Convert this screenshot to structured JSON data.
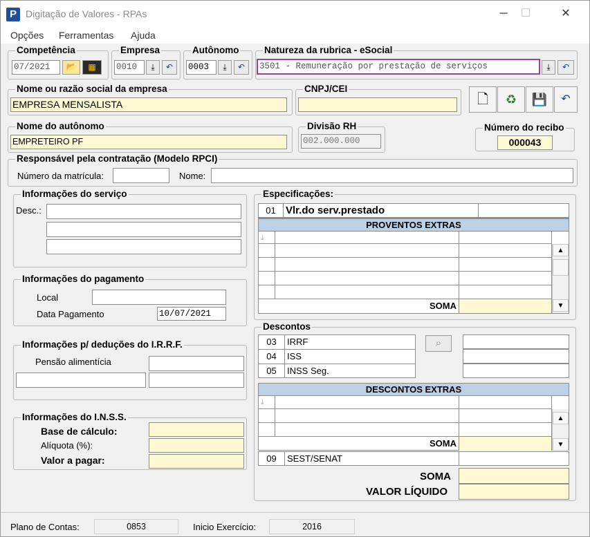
{
  "window": {
    "title": "Digitação de Valores - RPAs",
    "icon": "P",
    "minimize": "─",
    "maximize": "☐",
    "close": "✕"
  },
  "menu": [
    "Opções",
    "Ferramentas",
    "Ajuda"
  ],
  "competencia": {
    "label": "Competência",
    "value": "07/2021"
  },
  "empresa": {
    "label": "Empresa",
    "value": "0010"
  },
  "autonomo": {
    "label": "Autônomo",
    "value": "0003"
  },
  "natureza": {
    "label": "Natureza da rubrica - eSocial",
    "value": "3501 - Remuneração por prestação de serviços"
  },
  "razao": {
    "label": "Nome ou razão social da empresa",
    "value": "EMPRESA MENSALISTA"
  },
  "cnpj": {
    "label": "CNPJ/CEI",
    "value": ""
  },
  "nome_autonomo": {
    "label": "Nome do autônomo",
    "value": "EMPRETEIRO PF"
  },
  "divisao": {
    "label": "Divisão RH",
    "value": "002.000.000"
  },
  "recibo": {
    "label": "Número do recibo",
    "value": "000043"
  },
  "responsavel": {
    "label": "Responsável pela contratação (Modelo RPCI)",
    "matricula_label": "Número da matrícula:",
    "nome_label": "Nome:"
  },
  "servico": {
    "label": "Informações do serviço",
    "desc_label": "Desc.:"
  },
  "pagamento": {
    "label": "Informações do pagamento",
    "local_label": "Local",
    "data_label": "Data Pagamento",
    "data_value": "10/07/2021"
  },
  "irrf": {
    "label": "Informações p/ deduções do I.R.R.F.",
    "pensao_label": "Pensão alimentícia"
  },
  "inss": {
    "label": "Informações do I.N.S.S.",
    "base_label": "Base de cálculo:",
    "aliquota_label": "Alíquota (%):",
    "valor_label": "Valor a pagar:"
  },
  "especificacoes": {
    "label": "Especificações:",
    "code": "01",
    "item": "Vlr.do serv.prestado",
    "proventos_header": "PROVENTOS EXTRAS",
    "soma": "SOMA"
  },
  "descontos": {
    "label": "Descontos",
    "items": [
      {
        "code": "03",
        "name": "IRRF"
      },
      {
        "code": "04",
        "name": "ISS"
      },
      {
        "code": "05",
        "name": "INSS Seg."
      }
    ],
    "extras_header": "DESCONTOS EXTRAS",
    "soma": "SOMA",
    "sest_code": "09",
    "sest_name": "SEST/SENAT"
  },
  "totais": {
    "soma": "SOMA",
    "valor_liquido": "VALOR LÍQUIDO"
  },
  "status": {
    "plano_label": "Plano de Contas:",
    "plano_value": "0853",
    "inicio_label": "Inicio Exercício:",
    "inicio_value": "2016"
  }
}
